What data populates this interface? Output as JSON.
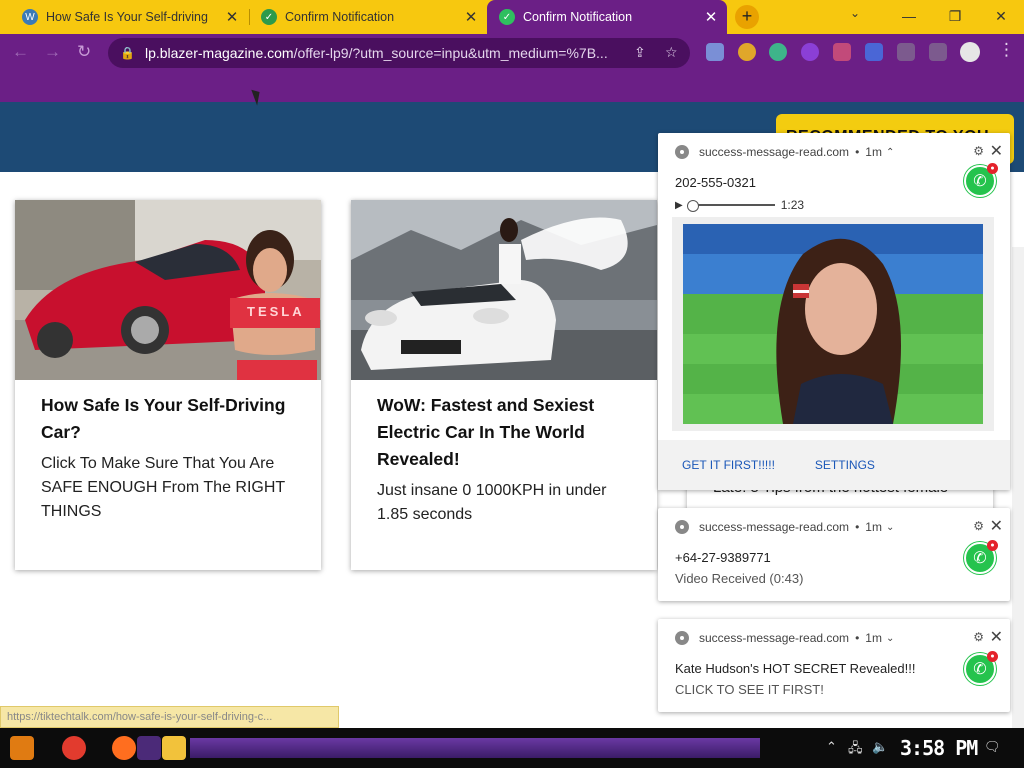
{
  "browser": {
    "tabs": [
      {
        "title": "How Safe Is Your Self-driving",
        "active": false
      },
      {
        "title": "Confirm Notification",
        "active": false
      },
      {
        "title": "Confirm Notification",
        "active": true
      }
    ],
    "new_tab_label": "+",
    "address": {
      "host": "lp.blazer-magazine.com",
      "path": "/offer-lp9/?utm_source=inpu&utm_medium=%7B..."
    },
    "status_url": "https://tiktechtalk.com/how-safe-is-your-self-driving-c..."
  },
  "page": {
    "recommended_label": "RECOMMENDED TO YOU",
    "cards": [
      {
        "title": "How Safe Is Your Self-Driving Car?",
        "text": "Click To Make Sure That You Are SAFE ENOUGH From The RIGHT THINGS",
        "image_label": "TESLA"
      },
      {
        "title": "WoW: Fastest and Sexiest Electric Car In The World Revealed!",
        "text": "Just insane 0 1000KPH in under 1.85 seconds"
      },
      {
        "text": "Late! 5 Tips from the hottest female"
      }
    ]
  },
  "notifications": [
    {
      "source": "success-message-read.com",
      "age": "1m",
      "line1": "202-555-0321",
      "audio_time": "1:23",
      "actions": [
        "GET IT FIRST!!!!!",
        "SETTINGS"
      ]
    },
    {
      "source": "success-message-read.com",
      "age": "1m",
      "line1": "+64-27-9389771",
      "line2": "Video Received (0:43)"
    },
    {
      "source": "success-message-read.com",
      "age": "1m",
      "line1": "Kate Hudson's HOT SECRET Revealed!!!",
      "line2": "CLICK TO SEE IT FIRST!"
    }
  ],
  "taskbar": {
    "clock": "3:58 PM"
  },
  "colors": {
    "tab_strip": "#f7c80f",
    "browser_theme": "#6b1f86",
    "page_header": "#1d4a75",
    "recommended": "#f3cc10",
    "whatsapp": "#25c34d"
  }
}
